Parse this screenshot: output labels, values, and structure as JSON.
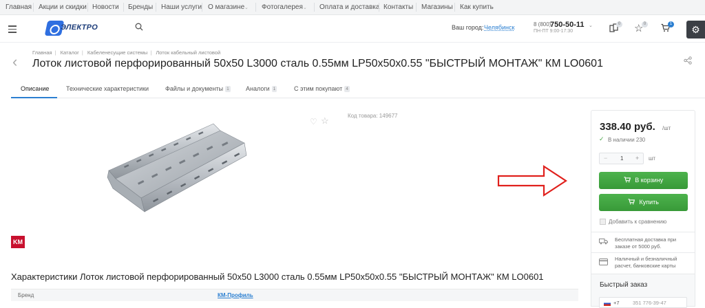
{
  "topnav": [
    "Главная",
    "Акции и скидки",
    "Новости",
    "Бренды",
    "Наши услуги",
    "О магазине",
    "Фотогалерея",
    "Оплата и доставка",
    "Контакты",
    "Магазины",
    "Как купить"
  ],
  "header": {
    "logo_text": "ЭЛЕКТРО",
    "city_label": "Ваш город:",
    "city": "Челябинск",
    "phone_prefix": "8 (800)",
    "phone_number": "750-50-11",
    "hours": "ПН-ПТ 9:00-17:30",
    "compare_count": "0",
    "fav_count": "0",
    "cart_count": "1"
  },
  "breadcrumbs": [
    "Главная",
    "Каталог",
    "Кабеленесущие системы",
    "Лоток кабельный листовой"
  ],
  "title": "Лоток листовой перфорированный 50x50 L3000 сталь 0.55мм LP50x50x0.55 \"БЫСТРЫЙ МОНТАЖ\" КМ LO0601",
  "tabs": [
    {
      "label": "Описание",
      "count": ""
    },
    {
      "label": "Технические характеристики",
      "count": ""
    },
    {
      "label": "Файлы и документы",
      "count": "1"
    },
    {
      "label": "Аналоги",
      "count": "1"
    },
    {
      "label": "С этим покупают",
      "count": "4"
    }
  ],
  "article": "Код товара: 149677",
  "brand_logo": "KM",
  "characteristics_title": "Характеристики Лоток листовой перфорированный 50x50 L3000 сталь 0.55мм LP50x50x0.55 \"БЫСТРЫЙ МОНТАЖ\" КМ LO0601",
  "spec": {
    "key": "Бренд",
    "value": "КМ-Профиль"
  },
  "buy": {
    "price": "338.40 руб.",
    "price_unit": "/шт",
    "stock": "В наличии 230",
    "qty": "1",
    "qty_minus": "−",
    "qty_plus": "+",
    "unit": "шт",
    "cart_button": "В корзину",
    "buy_button": "Купить",
    "compare": "Добавить к сравнению",
    "delivery_text": "Бесплатная доставка при заказе от 5000 руб.",
    "payment_text": "Наличный и безналичный расчет, банковские карты",
    "quick_order": "Быстрый заказ",
    "phone_code": "+7",
    "phone_placeholder": "351 776-39-47"
  },
  "colors": {
    "accent": "#2b7fd1",
    "green": "#43a843",
    "arrow": "#e0201c"
  },
  "icons": [
    "menu-icon",
    "search-icon",
    "compare-icon",
    "star-icon",
    "cart-icon",
    "gear-icon",
    "share-icon",
    "back-arrow-icon",
    "heart-icon",
    "truck-icon",
    "card-icon",
    "check-icon"
  ]
}
